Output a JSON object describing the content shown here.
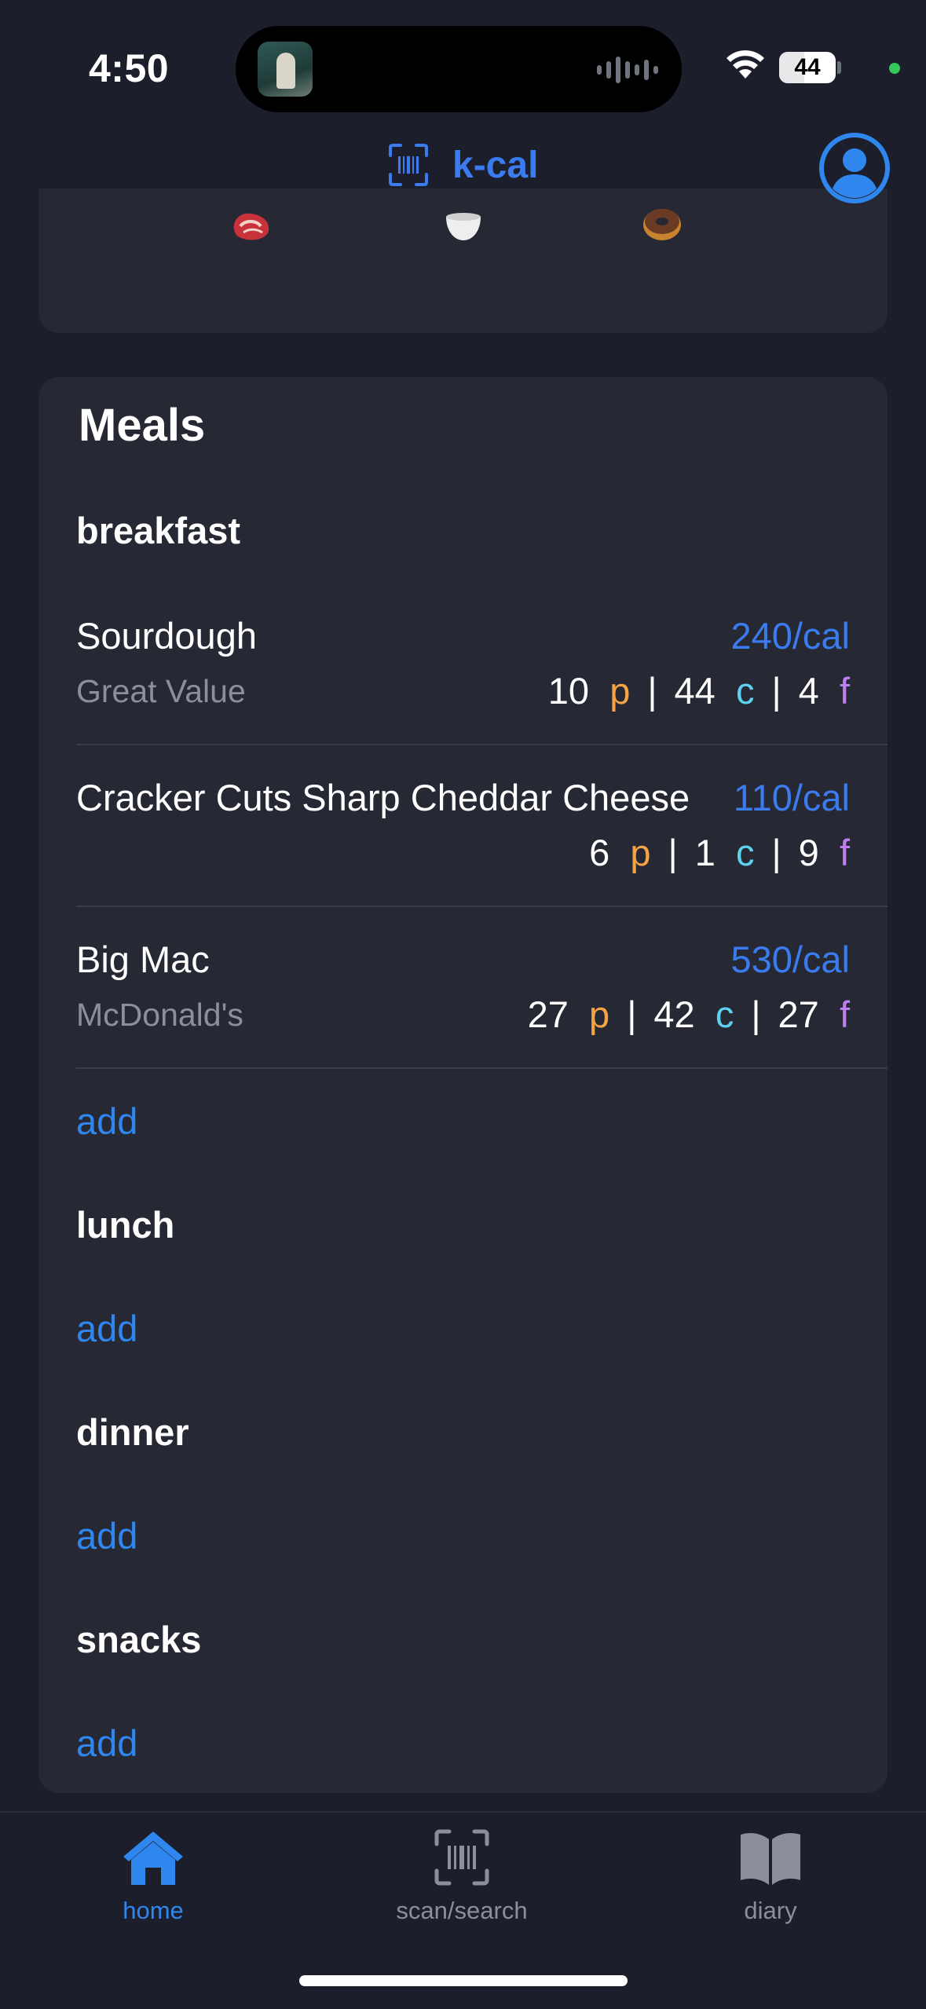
{
  "status": {
    "time": "4:50",
    "battery": "44"
  },
  "header": {
    "title": "k-cal"
  },
  "meals": {
    "title": "Meals",
    "sections": {
      "breakfast": {
        "label": "breakfast",
        "items": [
          {
            "name": "Sourdough",
            "brand": "Great Value",
            "calories": "240/cal",
            "protein": "10",
            "carbs": "44",
            "fat": "4"
          },
          {
            "name": "Cracker Cuts Sharp Cheddar Cheese",
            "brand": "",
            "calories": "110/cal",
            "protein": "6",
            "carbs": "1",
            "fat": "9"
          },
          {
            "name": "Big Mac",
            "brand": "McDonald's",
            "calories": "530/cal",
            "protein": "27",
            "carbs": "42",
            "fat": "27"
          }
        ],
        "add_label": "add"
      },
      "lunch": {
        "label": "lunch",
        "add_label": "add"
      },
      "dinner": {
        "label": "dinner",
        "add_label": "add"
      },
      "snacks": {
        "label": "snacks",
        "add_label": "add"
      }
    },
    "macro_letters": {
      "p": "p",
      "c": "c",
      "f": "f"
    },
    "separator": "|"
  },
  "tabs": [
    {
      "label": "home",
      "icon": "house-icon",
      "active": true
    },
    {
      "label": "scan/search",
      "icon": "barcode-scan-icon",
      "active": false
    },
    {
      "label": "diary",
      "icon": "book-icon",
      "active": false
    }
  ],
  "colors": {
    "accent": "#2f86ee",
    "title_blue": "#3a7bf0",
    "protein": "#f5a344",
    "carbs": "#5fd1f0",
    "fat": "#bf7ff2",
    "background": "#1c1f2b",
    "card": "#262934"
  }
}
